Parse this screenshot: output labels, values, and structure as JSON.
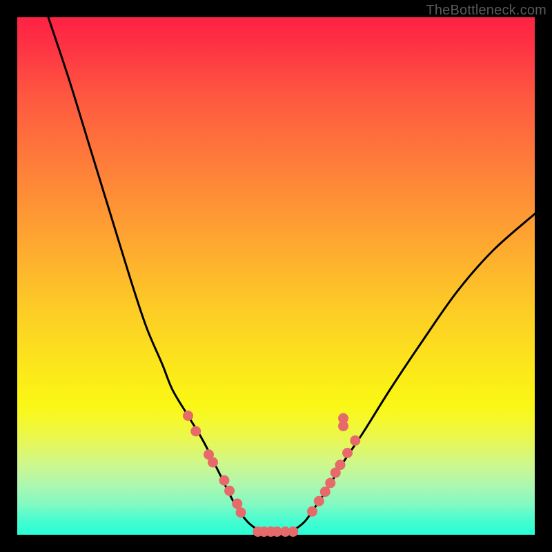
{
  "watermark": "TheBottleneck.com",
  "chart_data": {
    "type": "line",
    "title": "",
    "xlabel": "",
    "ylabel": "",
    "xlim": [
      0,
      100
    ],
    "ylim": [
      0,
      100
    ],
    "series": [
      {
        "name": "left-curve",
        "x": [
          6,
          10,
          14,
          18,
          22,
          25,
          28,
          30,
          33,
          36,
          39,
          42,
          44.5,
          47
        ],
        "y": [
          100,
          88,
          75,
          62,
          49,
          40,
          33,
          28,
          23,
          18,
          12,
          6,
          2.5,
          0.6
        ]
      },
      {
        "name": "right-curve",
        "x": [
          53,
          55.5,
          58,
          60,
          63,
          67,
          72,
          78,
          85,
          92,
          100
        ],
        "y": [
          0.6,
          2.5,
          6,
          9,
          14,
          20,
          28,
          37,
          47,
          55,
          62
        ]
      },
      {
        "name": "flat-min",
        "x": [
          47,
          48,
          49,
          50,
          51,
          52,
          53
        ],
        "y": [
          0.6,
          0.6,
          0.6,
          0.6,
          0.6,
          0.6,
          0.6
        ]
      }
    ],
    "markers": [
      {
        "x": 33.0,
        "y": 23.0
      },
      {
        "x": 34.5,
        "y": 20.0
      },
      {
        "x": 37.0,
        "y": 15.5
      },
      {
        "x": 37.8,
        "y": 14.0
      },
      {
        "x": 40.0,
        "y": 10.5
      },
      {
        "x": 41.0,
        "y": 8.5
      },
      {
        "x": 42.5,
        "y": 6.0
      },
      {
        "x": 43.2,
        "y": 4.3
      },
      {
        "x": 46.5,
        "y": 0.6
      },
      {
        "x": 47.7,
        "y": 0.6
      },
      {
        "x": 49.0,
        "y": 0.6
      },
      {
        "x": 50.2,
        "y": 0.6
      },
      {
        "x": 51.8,
        "y": 0.6
      },
      {
        "x": 53.3,
        "y": 0.6
      },
      {
        "x": 57.0,
        "y": 4.5
      },
      {
        "x": 58.3,
        "y": 6.5
      },
      {
        "x": 59.5,
        "y": 8.3
      },
      {
        "x": 60.5,
        "y": 10.0
      },
      {
        "x": 61.5,
        "y": 12.0
      },
      {
        "x": 62.4,
        "y": 13.5
      },
      {
        "x": 63.8,
        "y": 15.8
      },
      {
        "x": 65.3,
        "y": 18.2
      },
      {
        "x": 63.0,
        "y": 21.0
      },
      {
        "x": 63.0,
        "y": 22.5
      }
    ],
    "marker_color": "#e66a6a",
    "line_color": "#000000"
  }
}
